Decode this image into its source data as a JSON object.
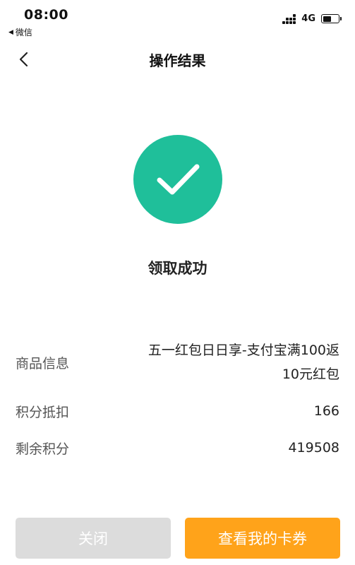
{
  "status_bar": {
    "time": "08:00",
    "back_app": "微信",
    "network": "4G",
    "battery_level": 0.55
  },
  "nav": {
    "title": "操作结果",
    "back_icon": "chevron-left-icon"
  },
  "result": {
    "icon": "checkmark-circle-icon",
    "icon_color": "#1fbf9a",
    "message": "领取成功"
  },
  "info": {
    "product_label": "商品信息",
    "product_value_line1": "五一红包日日享-支付宝满100返",
    "product_value_line2": "10元红包",
    "points_label": "积分抵扣",
    "points_value": "166",
    "remaining_label": "剩余积分",
    "remaining_value": "419508"
  },
  "buttons": {
    "close_label": "关闭",
    "view_coupons_label": "查看我的卡券",
    "accent_color": "#ffa31a"
  }
}
